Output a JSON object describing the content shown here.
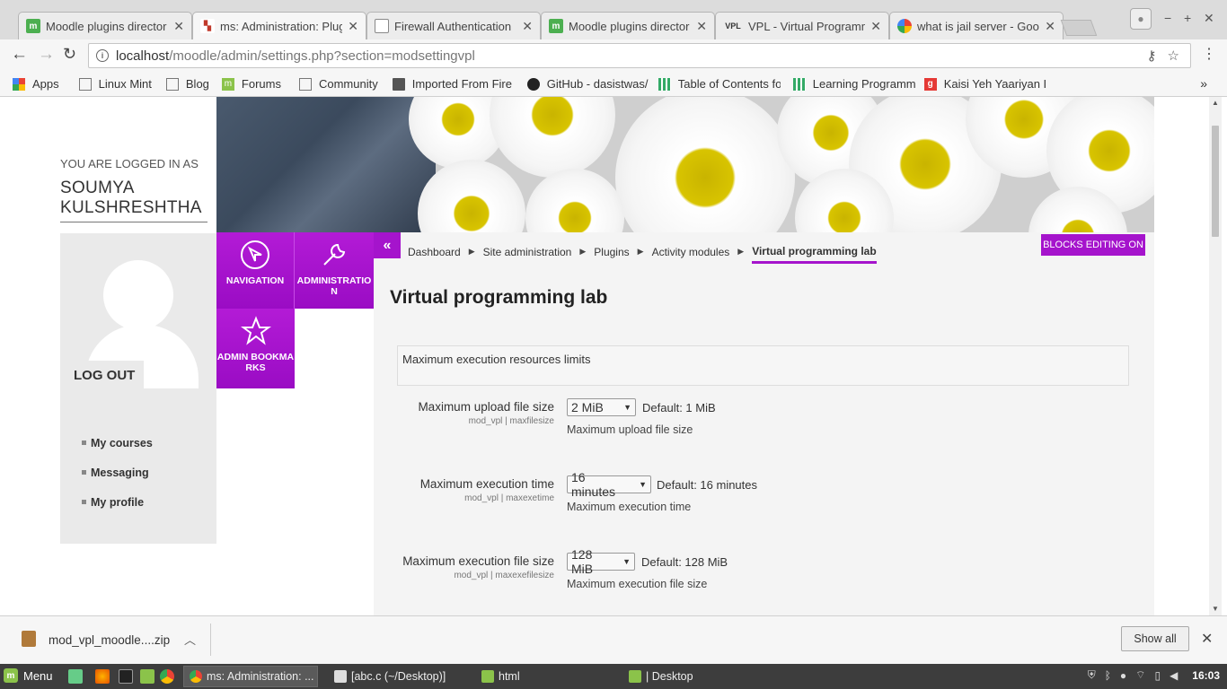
{
  "browser": {
    "tabs": [
      {
        "title": "Moodle plugins director",
        "icon": "moodle-icon"
      },
      {
        "title": "ms: Administration: Plug",
        "icon": "moodle-admin-icon"
      },
      {
        "title": "Firewall Authentication",
        "icon": "page-icon"
      },
      {
        "title": "Moodle plugins director",
        "icon": "moodle-icon"
      },
      {
        "title": "VPL - Virtual Programmi",
        "icon": "vpl-icon"
      },
      {
        "title": "what is jail server - Goo",
        "icon": "google-icon"
      }
    ],
    "active_tab": 1,
    "vpl_label": "VPL",
    "url_host": "localhost",
    "url_path": "/moodle/admin/settings.php?section=modsettingvpl",
    "bookmarks": [
      {
        "label": "Apps",
        "icon": "apps-icon"
      },
      {
        "label": "Linux Mint",
        "icon": "page-icon"
      },
      {
        "label": "Blog",
        "icon": "page-icon"
      },
      {
        "label": "Forums",
        "icon": "forums-icon"
      },
      {
        "label": "Community",
        "icon": "page-icon"
      },
      {
        "label": "Imported From Fire",
        "icon": "folder-icon"
      },
      {
        "label": "GitHub - dasistwas/",
        "icon": "github-icon"
      },
      {
        "label": "Table of Contents fo",
        "icon": "grid-icon"
      },
      {
        "label": "Learning Programm",
        "icon": "grid-icon"
      },
      {
        "label": "Kaisi Yeh Yaariyan I",
        "icon": "g-icon"
      }
    ],
    "bookmarks_more": "»"
  },
  "sidebar": {
    "logged_in_label": "YOU ARE LOGGED IN AS",
    "user_name": "SOUMYA KULSHRESHTHA",
    "logout_label": "LOG OUT",
    "links": [
      "My courses",
      "Messaging",
      "My profile"
    ]
  },
  "tiles": {
    "navigation": "NAVIGATION",
    "administration": "ADMINISTRATIO N",
    "admin_bookmarks": "ADMIN BOOKMA RKS",
    "collapse": "«"
  },
  "breadcrumb": [
    "Dashboard",
    "Site administration",
    "Plugins",
    "Activity modules",
    "Virtual programming lab"
  ],
  "blocks_editing": "BLOCKS EDITING ON",
  "main": {
    "title": "Virtual programming lab",
    "section_heading": "Maximum execution resources limits",
    "settings": [
      {
        "label": "Maximum upload file size",
        "sub": "mod_vpl | maxfilesize",
        "value": "2 MiB",
        "default": "Default: 1 MiB",
        "description": "Maximum upload file size"
      },
      {
        "label": "Maximum execution time",
        "sub": "mod_vpl | maxexetime",
        "value": "16 minutes",
        "default": "Default: 16 minutes",
        "description": "Maximum execution time"
      },
      {
        "label": "Maximum execution file size",
        "sub": "mod_vpl | maxexefilesize",
        "value": "128 MiB",
        "default": "Default: 128 MiB",
        "description": "Maximum execution file size"
      }
    ]
  },
  "download": {
    "filename": "mod_vpl_moodle....zip",
    "show_all": "Show all"
  },
  "taskbar": {
    "menu_label": "Menu",
    "tasks": [
      "ms: Administration: ...",
      "[abc.c (~/Desktop)]",
      "html",
      "| Desktop"
    ],
    "clock": "16:03"
  },
  "colors": {
    "accent": "#a514cc",
    "taskbar": "#3d3d3d"
  }
}
